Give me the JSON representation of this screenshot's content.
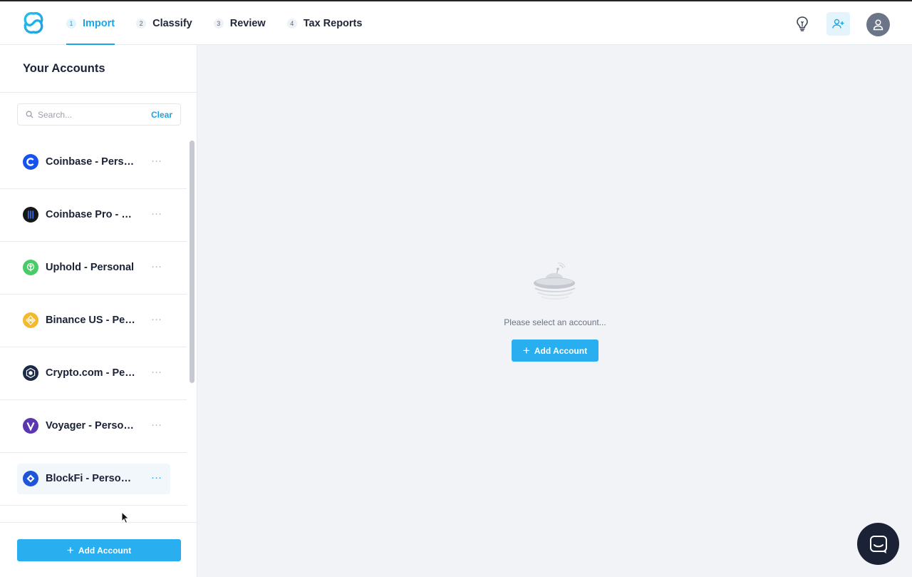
{
  "header": {
    "steps": [
      {
        "num": "1",
        "label": "Import",
        "active": true
      },
      {
        "num": "2",
        "label": "Classify",
        "active": false
      },
      {
        "num": "3",
        "label": "Review",
        "active": false
      },
      {
        "num": "4",
        "label": "Tax Reports",
        "active": false
      }
    ],
    "icons": [
      "lightbulb-icon",
      "add-user-icon",
      "user-avatar-icon"
    ],
    "accent_color": "#1aa5e6"
  },
  "sidebar": {
    "title": "Your Accounts",
    "search": {
      "placeholder": "Search...",
      "value": "",
      "clear_label": "Clear"
    },
    "accounts": [
      {
        "name": "Coinbase - Personal",
        "icon": "coinbase-icon",
        "color": "#1652f0"
      },
      {
        "name": "Coinbase Pro - Personal",
        "icon": "coinbase-pro-icon",
        "color": "#16171a"
      },
      {
        "name": "Uphold - Personal",
        "icon": "uphold-icon",
        "color": "#49cc68"
      },
      {
        "name": "Binance US - Personal",
        "icon": "binance-icon",
        "color": "#f3ba2f"
      },
      {
        "name": "Crypto.com - Personal",
        "icon": "crypto-com-icon",
        "color": "#1b2a47"
      },
      {
        "name": "Voyager - Personal",
        "icon": "voyager-icon",
        "color": "#5a36b0"
      },
      {
        "name": "BlockFi - Personal",
        "icon": "blockfi-icon",
        "color": "#1f55d9"
      }
    ],
    "add_button_label": "Add Account"
  },
  "main": {
    "empty_message": "Please select an account...",
    "add_button_label": "Add Account"
  }
}
